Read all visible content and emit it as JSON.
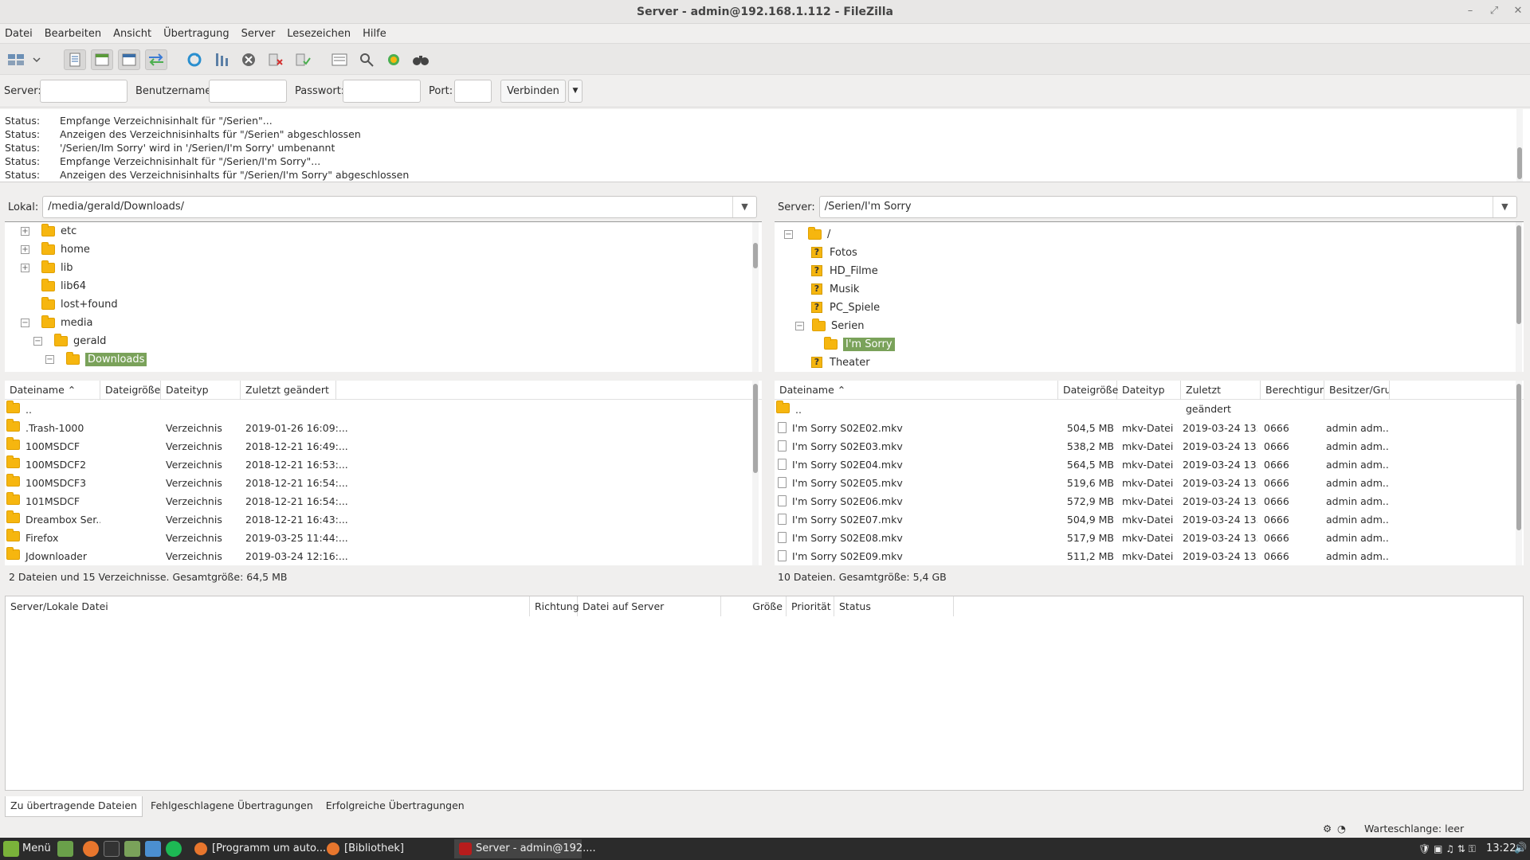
{
  "window": {
    "title": "Server - admin@192.168.1.112 - FileZilla"
  },
  "menu": [
    "Datei",
    "Bearbeiten",
    "Ansicht",
    "Übertragung",
    "Server",
    "Lesezeichen",
    "Hilfe"
  ],
  "quickconnect": {
    "server_label": "Server:",
    "server_value": "",
    "user_label": "Benutzername:",
    "user_value": "",
    "pass_label": "Passwort:",
    "pass_value": "",
    "port_label": "Port:",
    "port_value": "",
    "connect_label": "Verbinden"
  },
  "log": [
    {
      "k": "Status:",
      "v": "Empfange Verzeichnisinhalt für \"/Serien\"..."
    },
    {
      "k": "Status:",
      "v": "Anzeigen des Verzeichnisinhalts für \"/Serien\" abgeschlossen"
    },
    {
      "k": "Status:",
      "v": "'/Serien/Im Sorry' wird in '/Serien/I'm Sorry' umbenannt"
    },
    {
      "k": "Status:",
      "v": "Empfange Verzeichnisinhalt für \"/Serien/I'm Sorry\"..."
    },
    {
      "k": "Status:",
      "v": "Anzeigen des Verzeichnisinhalts für \"/Serien/I'm Sorry\" abgeschlossen"
    }
  ],
  "local": {
    "label": "Lokal:",
    "path": "/media/gerald/Downloads/",
    "tree": [
      {
        "name": "etc",
        "expander": "+"
      },
      {
        "name": "home",
        "expander": "+"
      },
      {
        "name": "lib",
        "expander": "+"
      },
      {
        "name": "lib64",
        "expander": ""
      },
      {
        "name": "lost+found",
        "expander": ""
      },
      {
        "name": "media",
        "expander": "−"
      },
      {
        "name": "gerald",
        "expander": "−"
      },
      {
        "name": "Downloads",
        "expander": "−"
      }
    ],
    "columns": [
      "Dateiname",
      "Dateigröße",
      "Dateityp",
      "Zuletzt geändert"
    ],
    "rows": [
      {
        "name": "..",
        "size": "",
        "type": "",
        "modified": ""
      },
      {
        "name": ".Trash-1000",
        "size": "",
        "type": "Verzeichnis",
        "modified": "2019-01-26 16:09:..."
      },
      {
        "name": "100MSDCF",
        "size": "",
        "type": "Verzeichnis",
        "modified": "2018-12-21 16:49:..."
      },
      {
        "name": "100MSDCF2",
        "size": "",
        "type": "Verzeichnis",
        "modified": "2018-12-21 16:53:..."
      },
      {
        "name": "100MSDCF3",
        "size": "",
        "type": "Verzeichnis",
        "modified": "2018-12-21 16:54:..."
      },
      {
        "name": "101MSDCF",
        "size": "",
        "type": "Verzeichnis",
        "modified": "2018-12-21 16:54:..."
      },
      {
        "name": "Dreambox Ser...",
        "size": "",
        "type": "Verzeichnis",
        "modified": "2018-12-21 16:43:..."
      },
      {
        "name": "Firefox",
        "size": "",
        "type": "Verzeichnis",
        "modified": "2019-03-25 11:44:..."
      },
      {
        "name": "Jdownloader",
        "size": "",
        "type": "Verzeichnis",
        "modified": "2019-03-24 12:16:..."
      }
    ],
    "summary": "2 Dateien und 15 Verzeichnisse. Gesamtgröße: 64,5 MB"
  },
  "remote": {
    "label": "Server:",
    "path": "/Serien/I'm Sorry",
    "tree": [
      {
        "name": "/"
      },
      {
        "name": "Fotos"
      },
      {
        "name": "HD_Filme"
      },
      {
        "name": "Musik"
      },
      {
        "name": "PC_Spiele"
      },
      {
        "name": "Serien"
      },
      {
        "name": "I'm Sorry"
      },
      {
        "name": "Theater"
      }
    ],
    "columns": [
      "Dateiname",
      "Dateigröße",
      "Dateityp",
      "Zuletzt geändert",
      "Berechtigung",
      "Besitzer/Gruppe"
    ],
    "rows": [
      {
        "name": "..",
        "size": "",
        "type": "",
        "modified": "",
        "perm": "",
        "owner": ""
      },
      {
        "name": "I'm Sorry S02E02.mkv",
        "size": "504,5 MB",
        "type": "mkv-Datei",
        "modified": "2019-03-24 13...",
        "perm": "0666",
        "owner": "admin adm..."
      },
      {
        "name": "I'm Sorry S02E03.mkv",
        "size": "538,2 MB",
        "type": "mkv-Datei",
        "modified": "2019-03-24 13...",
        "perm": "0666",
        "owner": "admin adm..."
      },
      {
        "name": "I'm Sorry S02E04.mkv",
        "size": "564,5 MB",
        "type": "mkv-Datei",
        "modified": "2019-03-24 13...",
        "perm": "0666",
        "owner": "admin adm..."
      },
      {
        "name": "I'm Sorry S02E05.mkv",
        "size": "519,6 MB",
        "type": "mkv-Datei",
        "modified": "2019-03-24 13...",
        "perm": "0666",
        "owner": "admin adm..."
      },
      {
        "name": "I'm Sorry S02E06.mkv",
        "size": "572,9 MB",
        "type": "mkv-Datei",
        "modified": "2019-03-24 13...",
        "perm": "0666",
        "owner": "admin adm..."
      },
      {
        "name": "I'm Sorry S02E07.mkv",
        "size": "504,9 MB",
        "type": "mkv-Datei",
        "modified": "2019-03-24 13...",
        "perm": "0666",
        "owner": "admin adm..."
      },
      {
        "name": "I'm Sorry S02E08.mkv",
        "size": "517,9 MB",
        "type": "mkv-Datei",
        "modified": "2019-03-24 13...",
        "perm": "0666",
        "owner": "admin adm..."
      },
      {
        "name": "I'm Sorry S02E09.mkv",
        "size": "511,2 MB",
        "type": "mkv-Datei",
        "modified": "2019-03-24 13...",
        "perm": "0666",
        "owner": "admin adm..."
      }
    ],
    "summary": "10 Dateien. Gesamtgröße: 5,4 GB"
  },
  "queue": {
    "columns": [
      "Server/Lokale Datei",
      "Richtung",
      "Datei auf Server",
      "Größe",
      "Priorität",
      "Status"
    ],
    "tabs": [
      "Zu übertragende Dateien",
      "Fehlgeschlagene Übertragungen",
      "Erfolgreiche Übertragungen"
    ],
    "status": "Warteschlange: leer"
  },
  "taskbar": {
    "menu": "Menü",
    "tasks": [
      "[Programm um auto...",
      "[Bibliothek]",
      "Server - admin@192...."
    ],
    "clock": "13:22"
  },
  "colors": {
    "accent": "#7aa25a",
    "folder": "#f6b60f",
    "taskbar": "#2b2b2b"
  }
}
